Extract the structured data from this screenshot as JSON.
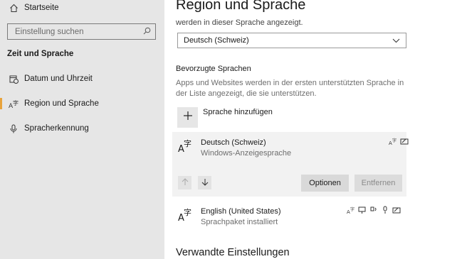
{
  "sidebar": {
    "home_label": "Startseite",
    "search_placeholder": "Einstellung suchen",
    "section_title": "Zeit und Sprache",
    "items": [
      {
        "label": "Datum und Uhrzeit"
      },
      {
        "label": "Region und Sprache"
      },
      {
        "label": "Spracherkennung"
      }
    ]
  },
  "main": {
    "page_title": "Region und Sprache",
    "display_language_desc": "werden in dieser Sprache angezeigt.",
    "display_language_value": "Deutsch (Schweiz)",
    "preferred_heading": "Bevorzugte Sprachen",
    "preferred_desc": "Apps und Websites werden in der ersten unterstützten Sprache in der Liste angezeigt, die sie unterstützen.",
    "add_language_label": "Sprache hinzufügen",
    "languages": [
      {
        "name": "Deutsch (Schweiz)",
        "sub": "Windows-Anzeigesprache"
      },
      {
        "name": "English (United States)",
        "sub": "Sprachpaket installiert"
      }
    ],
    "options_button": "Optionen",
    "remove_button": "Entfernen",
    "related_heading": "Verwandte Einstellungen"
  },
  "colors": {
    "accent": "#e8a33c",
    "sidebar_bg": "#e6e6e6",
    "selected_row_bg": "#f2f2f2"
  },
  "icons": {
    "home": "home-icon",
    "search": "search-icon",
    "calendar_clock": "calendar-clock-icon",
    "language": "language-icon",
    "microphone": "microphone-icon",
    "chevron": "chevron-down-icon",
    "plus": "plus-icon",
    "arrow_up": "arrow-up-icon",
    "arrow_down": "arrow-down-icon"
  }
}
